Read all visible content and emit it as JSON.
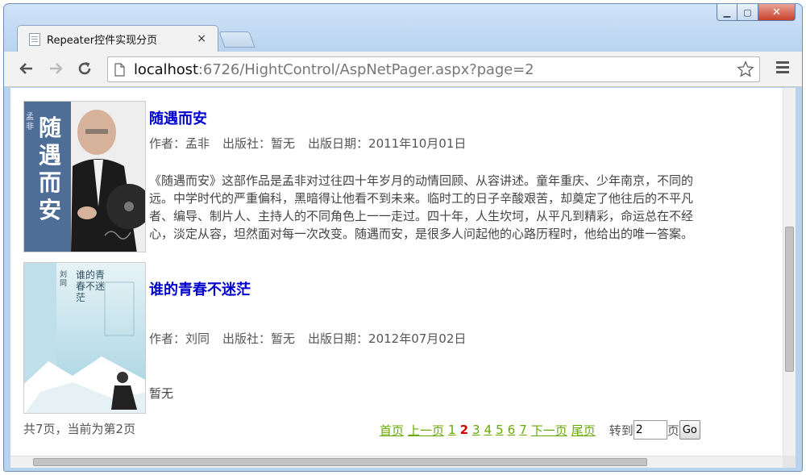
{
  "tab": {
    "title": "Repeater控件实现分页",
    "close": "×"
  },
  "window_controls": {
    "minimize": "▁",
    "maximize": "▢",
    "close": "✕"
  },
  "address": {
    "host": "localhost",
    "rest": ":6726/HightControl/AspNetPager.aspx?page=2"
  },
  "books": [
    {
      "cover_text": "随遇而安",
      "cover_author": "孟非",
      "title": "随遇而安",
      "author": "作者：孟非",
      "publisher": "出版社：暂无",
      "date": "出版日期：2011年10月01日",
      "description": [
        "《随遇而安》这部作品是孟非对过往四十年岁月的动情回顾、从容讲述。童年重庆、少年南京，不同的",
        "远。中学时代的严重偏科，黑暗得让他看不到未来。临时工的日子辛酸艰苦，却奠定了他往后的不平凡",
        "者、编导、制片人、主持人的不同角色上一一走过。四十年，人生坎坷，从平凡到精彩，命运总在不经",
        "心，淡定从容，坦然面对每一次改变。随遇而安，是很多人问起他的心路历程时，他给出的唯一答案。"
      ]
    },
    {
      "cover_text": "谁的青春不迷茫",
      "cover_author": "刘同",
      "title": "谁的青春不迷茫",
      "author": "作者：刘同",
      "publisher": "出版社：暂无",
      "date": "出版日期：2012年07月02日",
      "description": [
        "暂无"
      ]
    }
  ],
  "pager": {
    "info": "共7页，当前为第2页",
    "first": "首页",
    "prev": "上一页",
    "pages": [
      "1",
      "2",
      "3",
      "4",
      "5",
      "6",
      "7"
    ],
    "current_page": "2",
    "next": "下一页",
    "last": "尾页",
    "goto_label": "转到",
    "goto_value": "2",
    "page_suffix": "页",
    "go": "Go"
  },
  "colors": {
    "link": "#0000cc",
    "pager_link": "#66aa00",
    "current": "#cc0000"
  }
}
